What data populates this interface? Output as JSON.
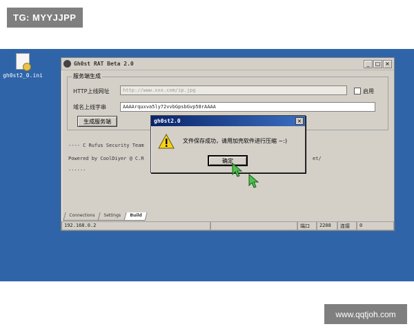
{
  "watermarks": {
    "top": "TG: MYYJJPP",
    "bottom": "www.qqtjoh.com"
  },
  "desktop": {
    "icon_label": "gh0st2_0.ini"
  },
  "window": {
    "title": "Gh0st RAT Beta 2.0",
    "controls": {
      "minimize": "_",
      "maximize": "□",
      "close": "×"
    },
    "group_title": "服务端生成",
    "http_label": "HTTP上线网址",
    "http_value": "http://www.xxx.com/ip.jpg",
    "enable_label": "启用",
    "domain_label": "域名上线字串",
    "domain_value": "AAAArquxva5ly72vvbGpsbGvp58rAAAA",
    "generate_button": "生成服务端",
    "log_lines": [
      "---- C Rufus Security Team",
      "Powered by CoolDiyer @ C.R",
      "......"
    ],
    "log_right_fragment": "et/",
    "tabs": [
      "Connections",
      "Settings",
      "Build"
    ],
    "status": {
      "ip": "192.168.0.2",
      "port_label": "端口",
      "port_value": "2208",
      "conn_label": "连接",
      "conn_value": "0"
    }
  },
  "dialog": {
    "title": "gh0st2.0",
    "close": "×",
    "message": "文件保存成功，请用加壳软件进行压缩 ~:)",
    "ok_button": "确定"
  }
}
